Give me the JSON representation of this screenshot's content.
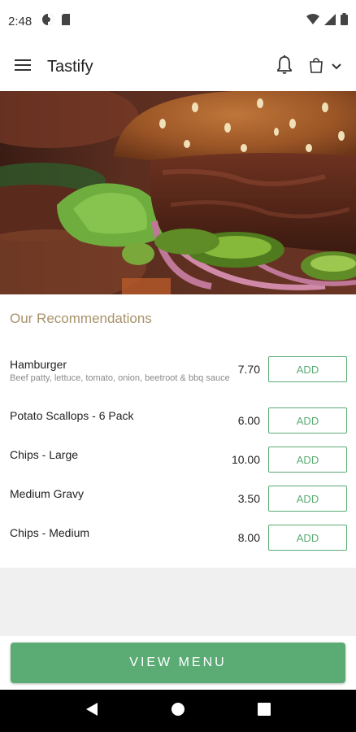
{
  "status_bar": {
    "time": "2:48"
  },
  "app_bar": {
    "title": "Tastify"
  },
  "section": {
    "title": "Our Recommendations"
  },
  "items": [
    {
      "name": "Hamburger",
      "description": "Beef patty, lettuce, tomato, onion, beetroot & bbq sauce",
      "price": "7.70",
      "add_label": "ADD"
    },
    {
      "name": "Potato Scallops - 6 Pack",
      "description": "",
      "price": "6.00",
      "add_label": "ADD"
    },
    {
      "name": "Chips - Large",
      "description": "",
      "price": "10.00",
      "add_label": "ADD"
    },
    {
      "name": "Medium Gravy",
      "description": "",
      "price": "3.50",
      "add_label": "ADD"
    },
    {
      "name": "Chips - Medium",
      "description": "",
      "price": "8.00",
      "add_label": "ADD"
    }
  ],
  "footer": {
    "view_menu_label": "VIEW MENU"
  },
  "colors": {
    "accent": "#5aab74",
    "section_title": "#a8926b",
    "gray_band": "#f0f0f0"
  },
  "icons": [
    "menu-icon",
    "bell-icon",
    "shopping-bag-icon",
    "chevron-down-icon",
    "wifi-icon",
    "signal-icon",
    "battery-icon",
    "back-icon",
    "home-icon",
    "recents-icon"
  ]
}
